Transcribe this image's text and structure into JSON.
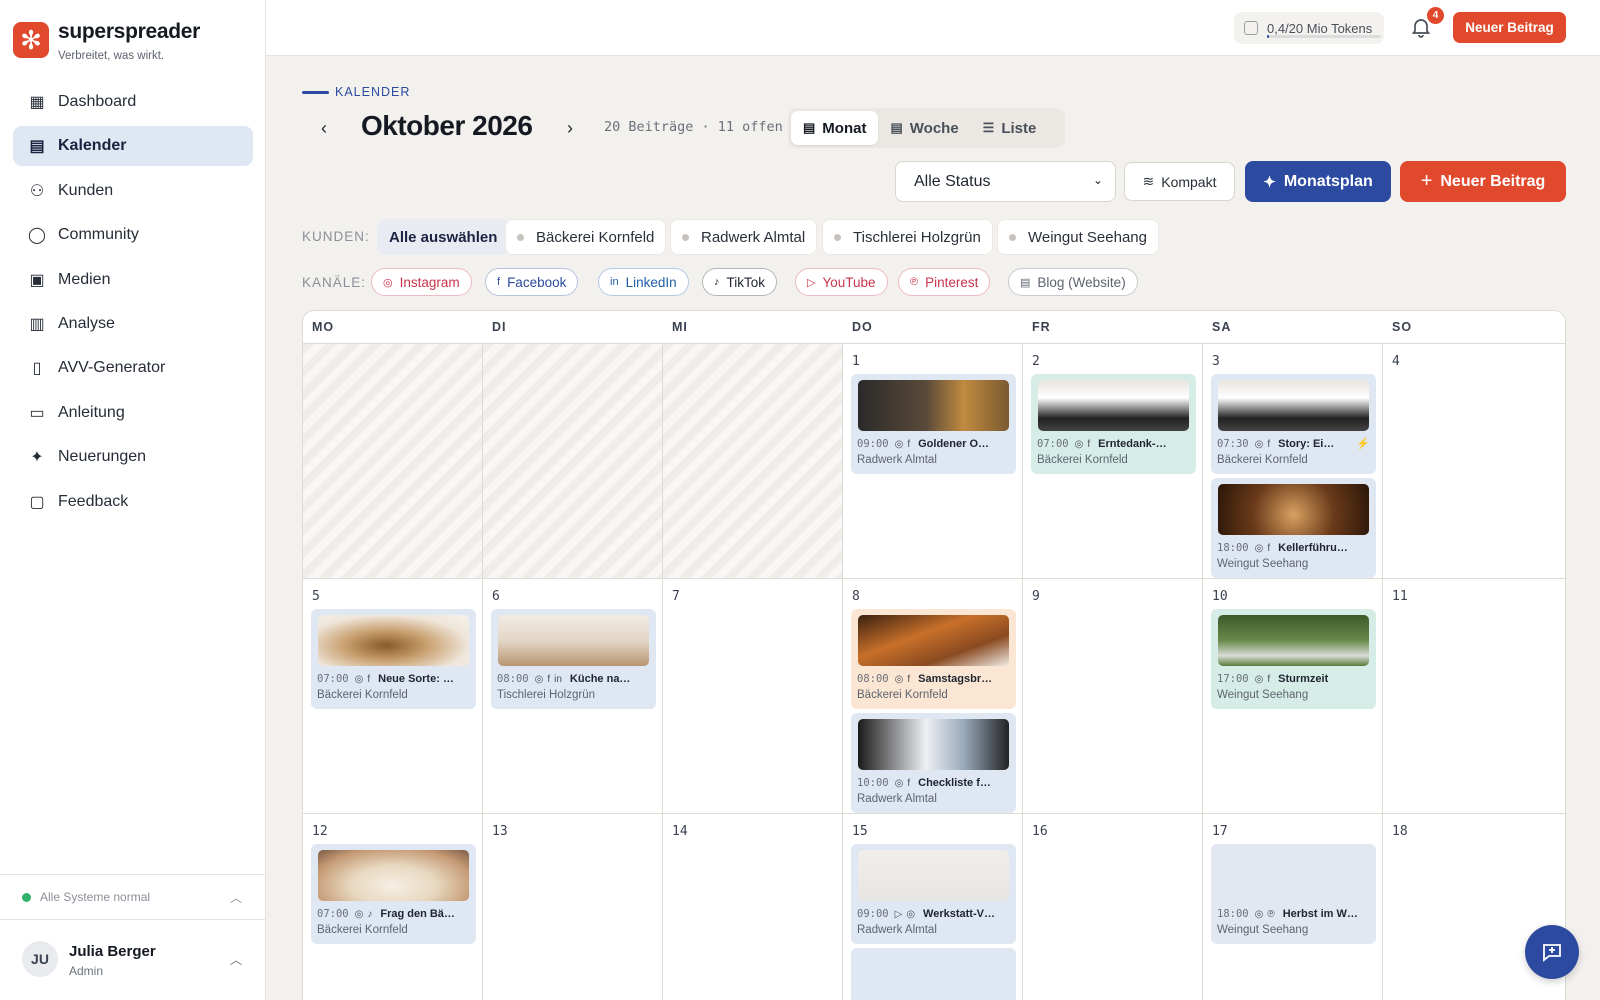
{
  "app": {
    "name": "superspreader",
    "tagline": "Verbreitet, was wirkt."
  },
  "sidebar": {
    "items": [
      {
        "label": "Dashboard",
        "icon": "grid-icon",
        "active": false
      },
      {
        "label": "Kalender",
        "icon": "calendar-icon",
        "active": true
      },
      {
        "label": "Kunden",
        "icon": "users-icon",
        "active": false
      },
      {
        "label": "Community",
        "icon": "chat-bubble-icon",
        "active": false
      },
      {
        "label": "Medien",
        "icon": "image-gallery-icon",
        "active": false
      },
      {
        "label": "Analyse",
        "icon": "bar-chart-icon",
        "active": false
      },
      {
        "label": "AVV-Generator",
        "icon": "document-icon",
        "active": false
      },
      {
        "label": "Anleitung",
        "icon": "book-icon",
        "active": false
      },
      {
        "label": "Neuerungen",
        "icon": "sparkle-icon",
        "active": false
      },
      {
        "label": "Feedback",
        "icon": "message-square-icon",
        "active": false
      }
    ],
    "status": "Alle Systeme normal",
    "user": {
      "initials": "JU",
      "name": "Julia Berger",
      "role": "Admin"
    }
  },
  "topbar": {
    "tokens": "0,4/20 Mio Tokens",
    "token_fraction": 0.02,
    "notifications": "4",
    "new_post": "Neuer Beitrag"
  },
  "header": {
    "kicker": "KALENDER",
    "month": "Oktober 2026",
    "counts": "20 Beiträge · 11 offen",
    "views": [
      {
        "label": "Monat",
        "icon": "calendar-icon",
        "active": true
      },
      {
        "label": "Woche",
        "icon": "calendar-week-icon",
        "active": false
      },
      {
        "label": "Liste",
        "icon": "list-icon",
        "active": false
      }
    ],
    "status_select": "Alle Status",
    "kompakt": "Kompakt",
    "monatsplan": "Monatsplan",
    "new_post": "Neuer Beitrag"
  },
  "filters": {
    "clients_label": "KUNDEN:",
    "clients": [
      "Alle auswählen",
      "Bäckerei Kornfeld",
      "Radwerk Almtal",
      "Tischlerei Holzgrün",
      "Weingut Seehang"
    ],
    "channels_label": "KANÄLE:",
    "channels": [
      {
        "label": "Instagram",
        "color": "#c8344b",
        "icon": "instagram-icon"
      },
      {
        "label": "Facebook",
        "color": "#2b4aa0",
        "icon": "facebook-icon"
      },
      {
        "label": "LinkedIn",
        "color": "#1f5fa8",
        "icon": "linkedin-icon"
      },
      {
        "label": "TikTok",
        "color": "#1f2530",
        "icon": "tiktok-icon"
      },
      {
        "label": "YouTube",
        "color": "#c8344b",
        "icon": "youtube-icon"
      },
      {
        "label": "Pinterest",
        "color": "#c8344b",
        "icon": "pinterest-icon"
      },
      {
        "label": "Blog (Website)",
        "color": "#5d6470",
        "icon": "blog-icon"
      }
    ]
  },
  "calendar": {
    "weekdays": [
      "MO",
      "DI",
      "MI",
      "DO",
      "FR",
      "SA",
      "SO"
    ],
    "days": [
      {
        "n": "",
        "posts": []
      },
      {
        "n": "",
        "posts": []
      },
      {
        "n": "",
        "posts": []
      },
      {
        "n": "1",
        "posts": [
          {
            "time": "09:00",
            "icons": "instagram,facebook",
            "title": "Goldener O…",
            "client": "Radwerk Almtal",
            "color": "blue"
          }
        ]
      },
      {
        "n": "2",
        "posts": [
          {
            "time": "07:00",
            "icons": "instagram,facebook",
            "title": "Erntedank-…",
            "client": "Bäckerei Kornfeld",
            "color": "teal"
          }
        ]
      },
      {
        "n": "3",
        "posts": [
          {
            "time": "07:30",
            "icons": "instagram,facebook",
            "title": "Story: Ei…",
            "client": "Bäckerei Kornfeld",
            "color": "blue",
            "flash": true
          },
          {
            "time": "18:00",
            "icons": "instagram,facebook",
            "title": "Kellerführu…",
            "client": "Weingut Seehang",
            "color": "blue"
          }
        ]
      },
      {
        "n": "4",
        "posts": []
      },
      {
        "n": "5",
        "posts": [
          {
            "time": "07:00",
            "icons": "instagram,facebook",
            "title": "Neue Sorte: …",
            "client": "Bäckerei Kornfeld",
            "color": "blue"
          }
        ]
      },
      {
        "n": "6",
        "posts": [
          {
            "time": "08:00",
            "icons": "instagram,facebook,linkedin",
            "title": "Küche na…",
            "client": "Tischlerei Holzgrün",
            "color": "blue"
          }
        ]
      },
      {
        "n": "7",
        "posts": []
      },
      {
        "n": "8",
        "posts": [
          {
            "time": "08:00",
            "icons": "instagram,facebook",
            "title": "Samstagsbr…",
            "client": "Bäckerei Kornfeld",
            "color": "orange"
          },
          {
            "time": "10:00",
            "icons": "instagram,facebook",
            "title": "Checkliste f…",
            "client": "Radwerk Almtal",
            "color": "blue"
          }
        ]
      },
      {
        "n": "9",
        "posts": []
      },
      {
        "n": "10",
        "posts": [
          {
            "time": "17:00",
            "icons": "instagram,facebook",
            "title": "Sturmzeit",
            "client": "Weingut Seehang",
            "color": "teal"
          }
        ]
      },
      {
        "n": "11",
        "posts": []
      },
      {
        "n": "12",
        "posts": [
          {
            "time": "07:00",
            "icons": "instagram,tiktok",
            "title": "Frag den Bä…",
            "client": "Bäckerei Kornfeld",
            "color": "blue"
          }
        ]
      },
      {
        "n": "13",
        "posts": []
      },
      {
        "n": "14",
        "posts": []
      },
      {
        "n": "15",
        "posts": [
          {
            "time": "09:00",
            "icons": "youtube,instagram",
            "title": "Werkstatt-V…",
            "client": "Radwerk Almtal",
            "color": "blue"
          },
          {
            "time": "",
            "icons": "",
            "title": "",
            "client": "",
            "color": "blue"
          }
        ]
      },
      {
        "n": "16",
        "posts": []
      },
      {
        "n": "17",
        "posts": [
          {
            "time": "18:00",
            "icons": "instagram,pinterest",
            "title": "Herbst im W…",
            "client": "Weingut Seehang",
            "color": "bluefaint"
          }
        ]
      },
      {
        "n": "18",
        "posts": []
      }
    ]
  }
}
